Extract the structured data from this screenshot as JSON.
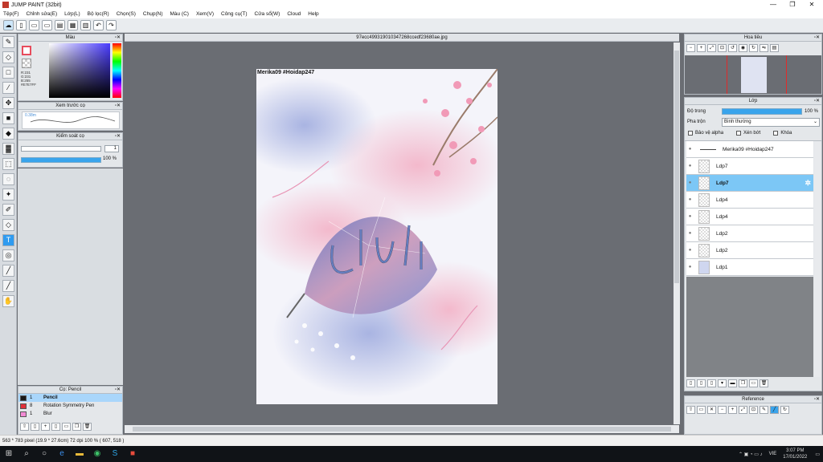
{
  "window": {
    "title": "JUMP PAINT (32bit)",
    "controls": [
      "—",
      "❐",
      "✕"
    ]
  },
  "menu": [
    "Tệp(F)",
    "Chỉnh sửa(E)",
    "Lớp(L)",
    "Bộ lọc(R)",
    "Chọn(S)",
    "Chụp(N)",
    "Màu (C)",
    "Xem(V)",
    "Công cụ(T)",
    "Cửa sổ(W)",
    "Cloud",
    "Help"
  ],
  "color_panel": {
    "title": "Màu",
    "rgb_r": "R:231",
    "rgb_g": "G:231",
    "rgb_b": "B:255",
    "hex": "#E7E7FF",
    "fg_color": "#E7E7FF"
  },
  "brush_preview_panel": {
    "title": "Xem trước cọ",
    "size_label": "0.38m"
  },
  "brush_control_panel": {
    "title": "Kiểm soát cọ",
    "size_value": "1",
    "opacity_value": "100 %"
  },
  "brush_panel": {
    "title": "Cọ: Pencil",
    "items": [
      {
        "size": "1",
        "name": "Pencil",
        "color": "#1a1a1a"
      },
      {
        "size": "8",
        "name": "Rotation Symmetry Pen",
        "color": "#e0303a"
      },
      {
        "size": "1",
        "name": "Blur",
        "color": "#f28ad4"
      }
    ]
  },
  "document_tab": "97ecc499319010347268ccedf23680ae.jpg",
  "canvas": {
    "header_text": "Merika09 #Hoidap247"
  },
  "navigator": {
    "title": "Hoa tiêu"
  },
  "layer_panel": {
    "title": "Lớp",
    "opacity_label": "Độ trong",
    "opacity_value": "100 %",
    "blend_label": "Pha trộn",
    "blend_value": "Bình thường",
    "checkboxes": [
      "Bảo vệ alpha",
      "Xén bớt",
      "Khóa"
    ],
    "layers": [
      {
        "name": "Merika09 #Hoidap247",
        "selected": false
      },
      {
        "name": "Ldp7",
        "selected": false
      },
      {
        "name": "Ldp7",
        "selected": true
      },
      {
        "name": "Ldp4",
        "selected": false
      },
      {
        "name": "Ldp4",
        "selected": false
      },
      {
        "name": "Ldp2",
        "selected": false
      },
      {
        "name": "Ldp2",
        "selected": false
      },
      {
        "name": "Ldp1",
        "selected": false
      }
    ]
  },
  "reference_panel": {
    "title": "Reference"
  },
  "status": {
    "text": "563 * 783 pixel   (19.9 * 27.6cm)   72 dpi   100 %   ( 607, 518 )"
  },
  "taskbar": {
    "time": "3:07 PM",
    "date": "17/01/2022",
    "lang": "VIE"
  }
}
